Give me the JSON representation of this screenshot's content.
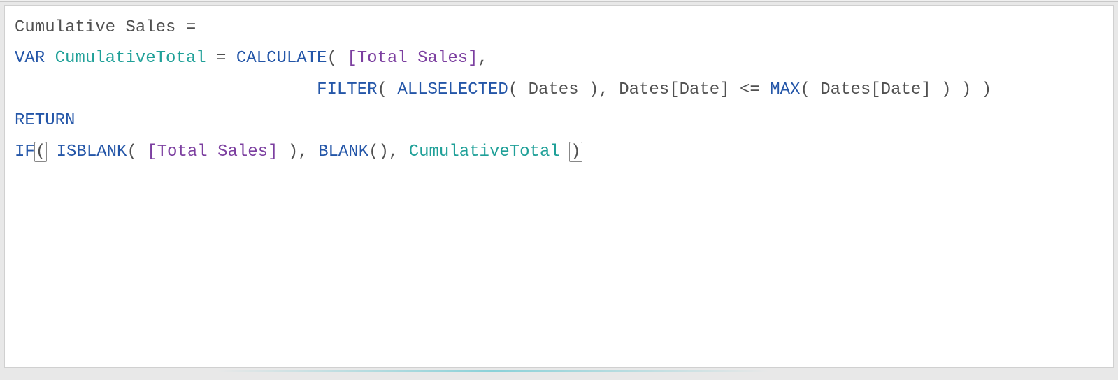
{
  "formula": {
    "measure_name": "Cumulative Sales",
    "eq": " =",
    "var_kw": "VAR",
    "var_name": " CumulativeTotal",
    "var_eq": " = ",
    "calc_fn": "CALCULATE",
    "op_open1": "( ",
    "total_sales_measure": "[Total Sales]",
    "comma1": ",",
    "indent2": "                              ",
    "filter_fn": "FILTER",
    "op_open2": "( ",
    "allselected_fn": "ALLSELECTED",
    "op_open3": "( ",
    "dates_tbl": "Dates",
    "op_close3": " ), ",
    "dates_col": "Dates[Date]",
    "lte": " <= ",
    "max_fn": "MAX",
    "op_open4": "( ",
    "dates_col2": "Dates[Date]",
    "op_close_all": " ) ) )",
    "return_kw": "RETURN",
    "if_fn": "IF",
    "bracket_open": "(",
    "isblank_fn": " ISBLANK",
    "op_open5": "( ",
    "total_sales_measure2": "[Total Sales]",
    "op_close5": " ), ",
    "blank_fn": "BLANK",
    "blank_parens": "(), ",
    "var_ref": "CumulativeTotal",
    "space_before_close": " ",
    "bracket_close": ")"
  }
}
